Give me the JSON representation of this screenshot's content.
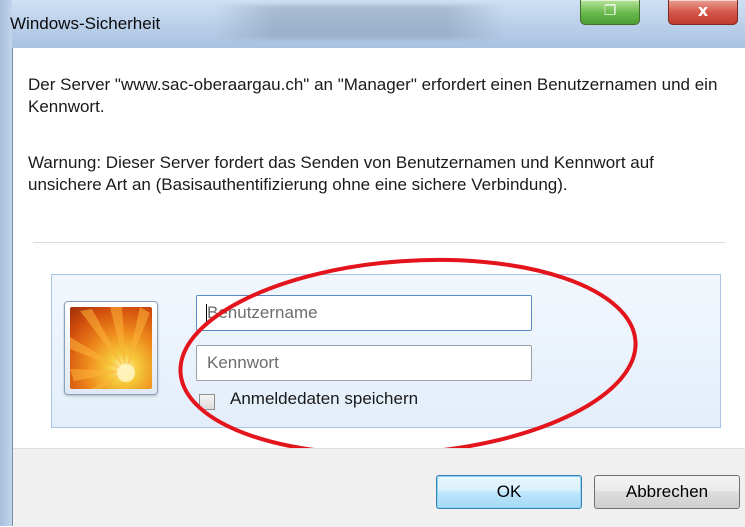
{
  "window": {
    "title": "Windows-Sicherheit",
    "restore_glyph": "❐",
    "close_glyph": "x"
  },
  "message": {
    "line1": "Der Server \"www.sac-oberaargau.ch\" an \"Manager\" erfordert einen Benutzernamen und ein Kennwort.",
    "warning": "Warnung: Dieser Server fordert das Senden von Benutzernamen und Kennwort auf unsichere Art an (Basisauthentifizierung ohne eine sichere Verbindung)."
  },
  "credentials": {
    "username_placeholder": "Benutzername",
    "password_placeholder": "Kennwort",
    "remember_label": "Anmeldedaten speichern",
    "remember_checked": false
  },
  "buttons": {
    "ok": "OK",
    "cancel": "Abbrechen"
  },
  "annotation": {
    "color": "#e3141b"
  }
}
